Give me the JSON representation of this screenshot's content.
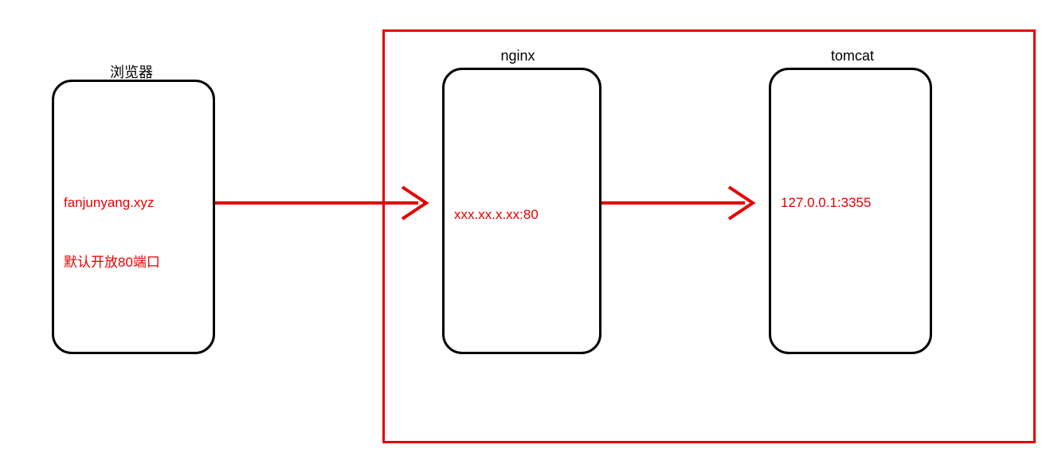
{
  "diagram": {
    "browser": {
      "label": "浏览器",
      "domain": "fanjunyang.xyz",
      "port_note": "默认开放80端口"
    },
    "nginx": {
      "label": "nginx",
      "address": "xxx.xx.x.xx:80"
    },
    "tomcat": {
      "label": "tomcat",
      "address": "127.0.0.1:3355"
    },
    "colors": {
      "accent": "#e60000",
      "box_border": "#000000"
    }
  }
}
